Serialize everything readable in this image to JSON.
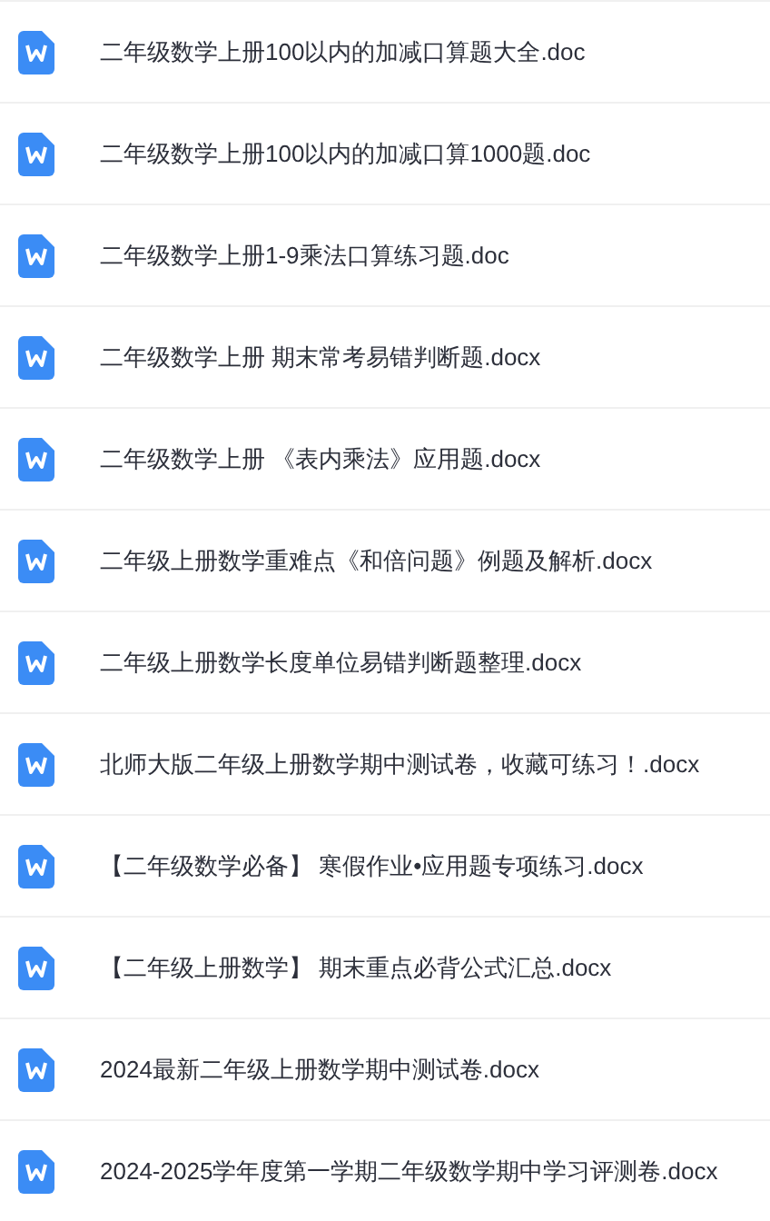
{
  "files": [
    {
      "name": "二年级数学上册100以内的加减口算题大全.doc"
    },
    {
      "name": "二年级数学上册100以内的加减口算1000题.doc"
    },
    {
      "name": "二年级数学上册1-9乘法口算练习题.doc"
    },
    {
      "name": "二年级数学上册 期末常考易错判断题.docx"
    },
    {
      "name": "二年级数学上册 《表内乘法》应用题.docx"
    },
    {
      "name": "二年级上册数学重难点《和倍问题》例题及解析.docx"
    },
    {
      "name": "二年级上册数学长度单位易错判断题整理.docx"
    },
    {
      "name": "北师大版二年级上册数学期中测试卷，收藏可练习！.docx"
    },
    {
      "name": "【二年级数学必备】 寒假作业•应用题专项练习.docx"
    },
    {
      "name": "【二年级上册数学】 期末重点必背公式汇总.docx"
    },
    {
      "name": "2024最新二年级上册数学期中测试卷.docx"
    },
    {
      "name": "2024-2025学年度第一学期二年级数学期中学习评测卷.docx"
    }
  ]
}
